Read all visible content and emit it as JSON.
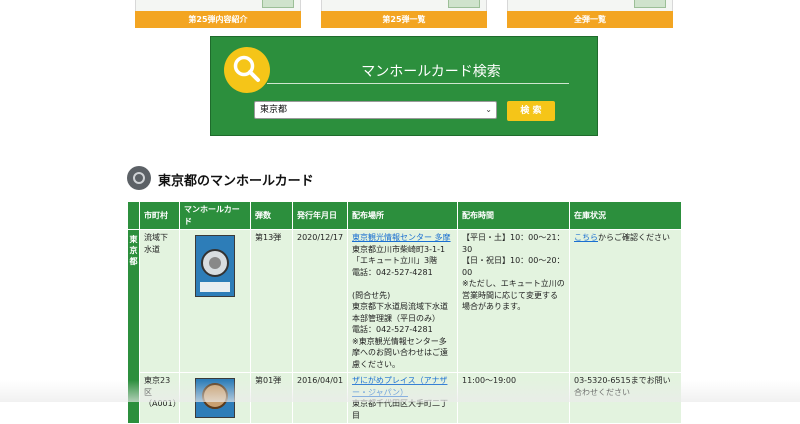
{
  "topnav": {
    "items": [
      {
        "label": "第25弾内容紹介"
      },
      {
        "label": "第25弾一覧"
      },
      {
        "label": "全弾一覧"
      }
    ]
  },
  "search": {
    "title": "マンホールカード検索",
    "selected": "東京都",
    "button": "検 索",
    "icon": "search-icon"
  },
  "section": {
    "title": "東京都のマンホールカード"
  },
  "table": {
    "headers": [
      "市町村",
      "マンホールカード",
      "弾数",
      "発行年月日",
      "配布場所",
      "配布時間",
      "在庫状況"
    ],
    "prefecture": "東京都",
    "rows": [
      {
        "city": "流域下水道",
        "issue": "第13弾",
        "date": "2020/12/17",
        "place_link": "東京観光情報センター 多摩",
        "place_lines": [
          "東京都立川市柴崎町3-1-1",
          "「エキュート立川」3階",
          "電話：042-527-4281",
          "",
          "(問合せ先)",
          "東京都下水道局流域下水道本部管理課（平日のみ）",
          "電話：042-527-4281",
          "※東京観光情報センター多摩へのお問い合わせはご遠慮ください。"
        ],
        "time_lines": [
          "【平日・土】10：00～21：30",
          "【日・祝日】10：00～20：00",
          "※ただし、エキュート立川の営業時間に応じて変更する場合があります。"
        ],
        "stock_link": "こちら",
        "stock_text": "からご確認ください"
      },
      {
        "city": "東京23区（A001）",
        "issue": "第01弾",
        "date": "2016/04/01",
        "place_link": "ザにがめプレイス（アナザー・ジャパン）",
        "place_lines": [
          "東京都千代田区大手町二丁目"
        ],
        "time_lines": [
          "11:00～19:00"
        ],
        "stock_link": "",
        "stock_text": "03-5320-6515までお問い合わせください"
      }
    ]
  }
}
